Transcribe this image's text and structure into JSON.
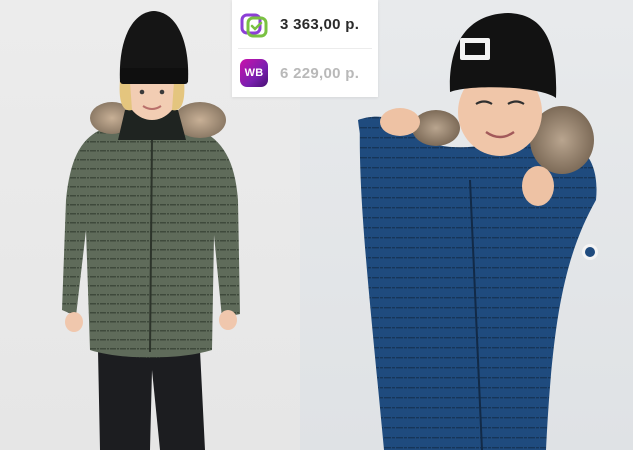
{
  "images": {
    "left_photo": "child-green-winter-parka",
    "right_photo": "child-blue-winter-parka"
  },
  "price_card": {
    "primary": {
      "icon": "megamarket-logo-icon",
      "price": "3 363,00 р.",
      "color": "#2b2b2b"
    },
    "secondary": {
      "icon_text": "WB",
      "price": "6 229,00 р.",
      "color": "#b9b9b9"
    }
  },
  "colors": {
    "megamarket_green": "#7ac142",
    "megamarket_purple": "#8c3fd6",
    "wb_gradient_start": "#cb11ab",
    "wb_gradient_end": "#481173"
  }
}
